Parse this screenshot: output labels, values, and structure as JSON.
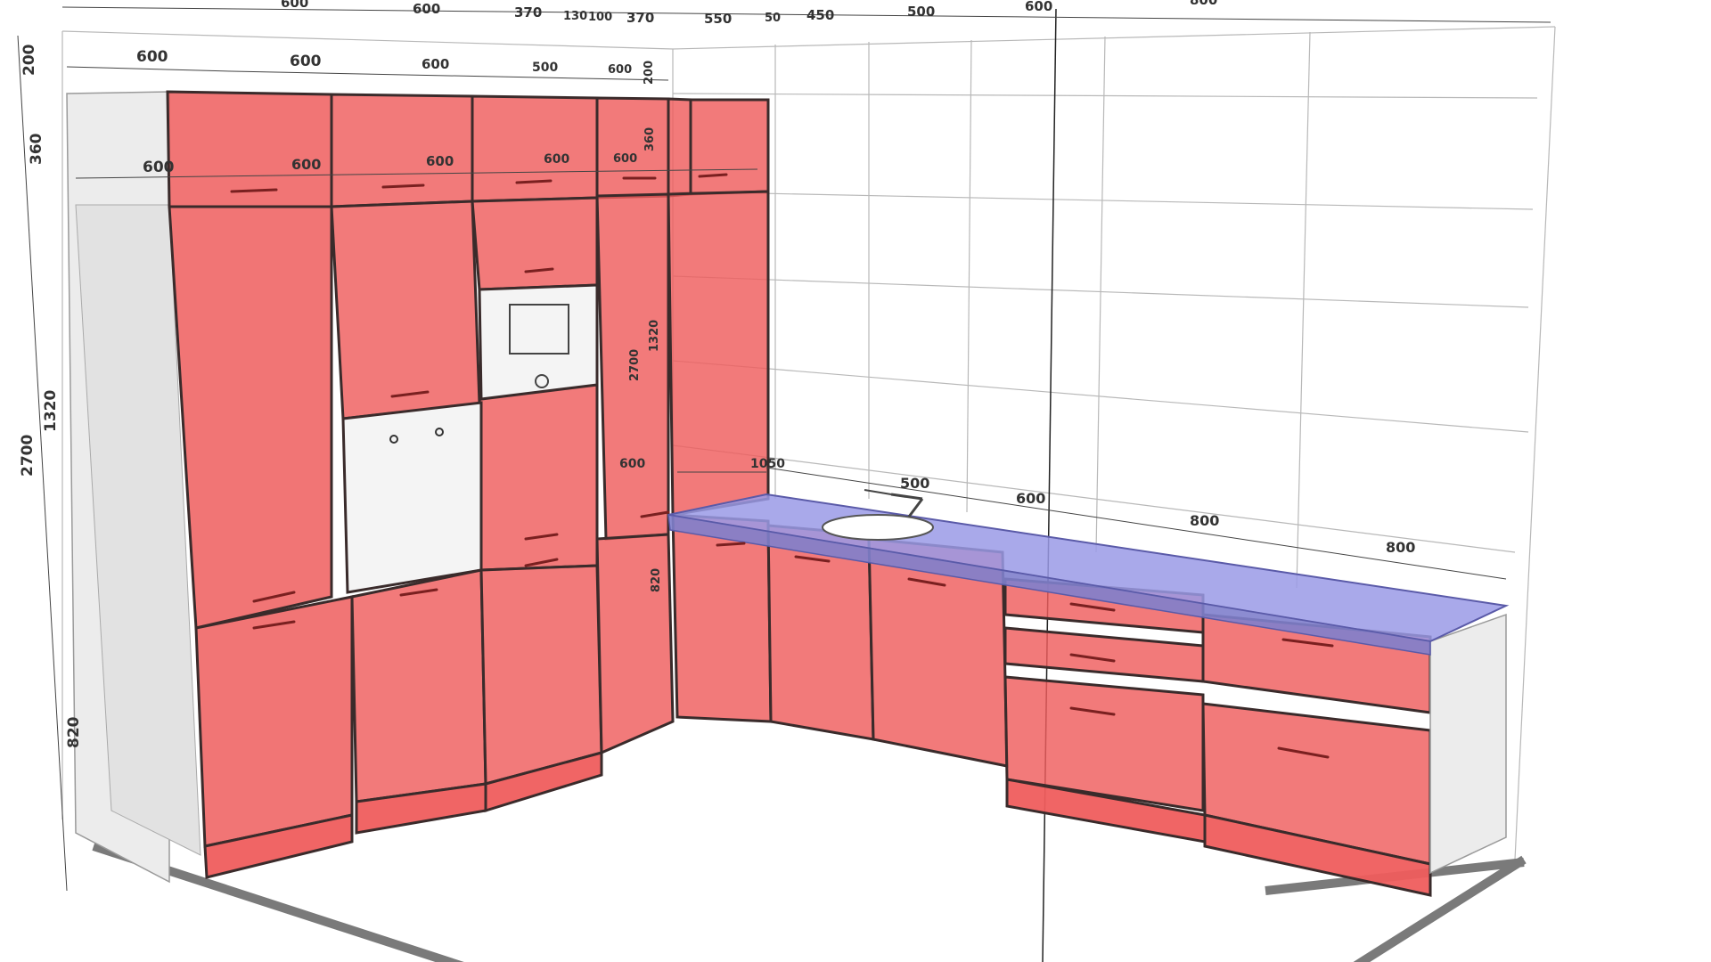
{
  "colors": {
    "cabinet_fill": "#ef5d5d",
    "cabinet_stroke": "#3a2b2b",
    "worktop_fill": "#9a9ae6",
    "side_panel_fill": "#ececec",
    "appliance_fill": "#f4f4f4",
    "floor_edge": "#7a7a7a",
    "grid_line": "#b8b8b8",
    "dimension_text": "#333333"
  },
  "dimensions": {
    "top_run": [
      "600",
      "600",
      "370",
      "130",
      "100",
      "370",
      "550",
      "50",
      "450",
      "500",
      "600",
      "800"
    ],
    "upper_widths": [
      "600",
      "600",
      "600",
      "500",
      "600"
    ],
    "upper_inner_widths": [
      "600",
      "600",
      "600",
      "600",
      "600"
    ],
    "left_heights": [
      "200",
      "360",
      "1320",
      "2700",
      "820"
    ],
    "inner_heights": [
      "200",
      "360",
      "1320",
      "2700",
      "820"
    ],
    "worktop_widths": [
      "600",
      "1050",
      "500",
      "600",
      "800",
      "800"
    ]
  }
}
